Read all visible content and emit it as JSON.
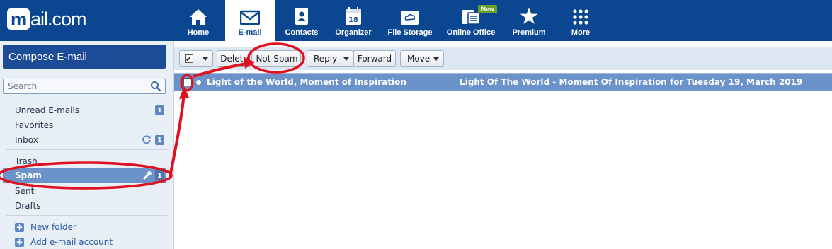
{
  "header": {
    "logo_mark": "m",
    "logo_text": "ail.com",
    "nav": [
      {
        "label": "Home",
        "icon": "home-icon"
      },
      {
        "label": "E-mail",
        "icon": "envelope-icon",
        "active": true
      },
      {
        "label": "Contacts",
        "icon": "contacts-icon"
      },
      {
        "label": "Organizer",
        "icon": "calendar-icon",
        "icon_text": "18"
      },
      {
        "label": "File Storage",
        "icon": "cloud-folder-icon"
      },
      {
        "label": "Online Office",
        "icon": "office-icon",
        "badge": "New"
      },
      {
        "label": "Premium",
        "icon": "star-icon"
      },
      {
        "label": "More",
        "icon": "grid-icon"
      }
    ]
  },
  "sidebar": {
    "compose_label": "Compose E-mail",
    "search_placeholder": "Search",
    "folders": [
      {
        "label": "Unread E-mails",
        "count": "1"
      },
      {
        "label": "Favorites"
      },
      {
        "label": "Inbox",
        "count": "1"
      },
      {
        "label": "Trash"
      },
      {
        "label": "Spam",
        "count": "1",
        "selected": true
      },
      {
        "label": "Sent"
      },
      {
        "label": "Drafts"
      }
    ],
    "actions": [
      {
        "label": "New folder"
      },
      {
        "label": "Add e-mail account"
      }
    ]
  },
  "toolbar": {
    "delete_label": "Delete",
    "not_spam_label": "Not Spam",
    "reply_label": "Reply",
    "forward_label": "Forward",
    "move_label": "Move"
  },
  "messages": [
    {
      "from": "Light of the World, Moment of Inspiration",
      "subject": "Light Of The World - Moment Of Inspiration for Tuesday 19, March 2019",
      "checked": true,
      "unread": true
    }
  ],
  "colors": {
    "header_bg": "#0b4690",
    "compose_bg": "#1c4c98",
    "selection": "#6b93c9",
    "annotation": "#e0101e"
  }
}
